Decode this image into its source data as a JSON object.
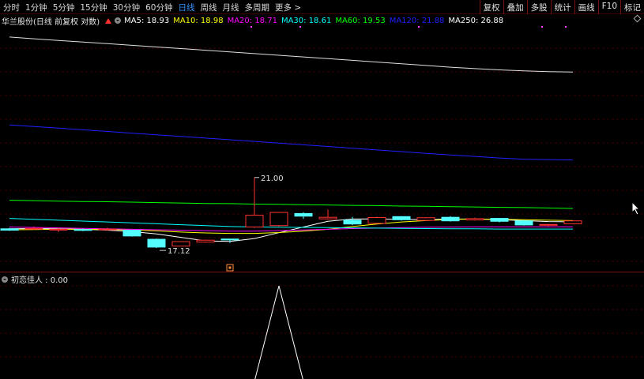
{
  "toolbar": {
    "period_tabs": [
      "分时",
      "1分钟",
      "5分钟",
      "15分钟",
      "30分钟",
      "60分钟",
      "日线",
      "周线",
      "月线",
      "多周期",
      "更多 >"
    ],
    "active_tab_index": 6,
    "right_tools": [
      "复权",
      "叠加",
      "多股",
      "统计",
      "画线",
      "F10",
      "标记"
    ]
  },
  "legend": {
    "stock_name": "华兰股份(日线 前复权 对数)",
    "ma": [
      {
        "label": "MA5: 18.93",
        "color": "#ffffff"
      },
      {
        "label": "MA10: 18.98",
        "color": "#ffff00"
      },
      {
        "label": "MA20: 18.71",
        "color": "#ff00ff"
      },
      {
        "label": "MA30: 18.61",
        "color": "#00ffff"
      },
      {
        "label": "MA60: 19.53",
        "color": "#00ff00"
      },
      {
        "label": "MA120: 21.88",
        "color": "#2020ff"
      },
      {
        "label": "MA250: 26.88",
        "color": "#ffffff"
      }
    ]
  },
  "annotations": {
    "high_label": "21.00",
    "low_label": "17.12"
  },
  "indicator": {
    "label": "初恋佳人 : 0.00"
  },
  "chart_data": {
    "type": "candlestick",
    "candles": [
      {
        "o": 18.62,
        "c": 18.56,
        "h": 18.66,
        "l": 18.53
      },
      {
        "o": 18.62,
        "c": 18.64,
        "h": 18.72,
        "l": 18.58
      },
      {
        "o": 18.6,
        "c": 18.6,
        "h": 18.66,
        "l": 18.48
      },
      {
        "o": 18.59,
        "c": 18.55,
        "h": 18.63,
        "l": 18.52
      },
      {
        "o": 18.61,
        "c": 18.61,
        "h": 18.67,
        "l": 18.55
      },
      {
        "o": 18.56,
        "c": 18.31,
        "h": 18.56,
        "l": 18.28
      },
      {
        "o": 18.17,
        "c": 17.84,
        "h": 18.2,
        "l": 17.8
      },
      {
        "o": 17.88,
        "c": 18.07,
        "h": 18.08,
        "l": 17.88
      },
      {
        "o": 18.05,
        "c": 18.13,
        "h": 18.15,
        "l": 18.02
      },
      {
        "o": 18.18,
        "c": 18.14,
        "h": 18.19,
        "l": 18.01
      },
      {
        "o": 18.7,
        "c": 19.22,
        "h": 21.0,
        "l": 18.66
      },
      {
        "o": 18.76,
        "c": 19.35,
        "h": 19.36,
        "l": 18.72
      },
      {
        "o": 19.3,
        "c": 19.18,
        "h": 19.36,
        "l": 19.06
      },
      {
        "o": 19.06,
        "c": 19.13,
        "h": 19.48,
        "l": 19.04
      },
      {
        "o": 19.0,
        "c": 18.83,
        "h": 19.15,
        "l": 18.78
      },
      {
        "o": 18.86,
        "c": 19.12,
        "h": 19.16,
        "l": 18.84
      },
      {
        "o": 19.16,
        "c": 19.02,
        "h": 19.18,
        "l": 18.98
      },
      {
        "o": 18.99,
        "c": 19.11,
        "h": 19.13,
        "l": 18.96
      },
      {
        "o": 19.13,
        "c": 18.97,
        "h": 19.18,
        "l": 18.94
      },
      {
        "o": 19.01,
        "c": 19.07,
        "h": 19.12,
        "l": 18.98
      },
      {
        "o": 19.08,
        "c": 18.95,
        "h": 19.1,
        "l": 18.9
      },
      {
        "o": 18.97,
        "c": 18.79,
        "h": 19.0,
        "l": 18.76
      },
      {
        "o": 18.79,
        "c": 18.81,
        "h": 18.83,
        "l": 18.74
      },
      {
        "o": 18.84,
        "c": 18.97,
        "h": 18.98,
        "l": 18.82
      }
    ],
    "ma_lines": {
      "MA5": [
        18.62,
        18.63,
        18.62,
        18.6,
        18.56,
        18.5,
        18.4,
        18.25,
        18.1,
        18.08,
        18.2,
        18.45,
        18.7,
        18.95,
        19.05,
        19.06,
        19.04,
        19.02,
        19.05,
        19.05,
        19.02,
        18.98,
        18.94,
        18.93
      ],
      "MA10": [
        18.58,
        18.59,
        18.6,
        18.6,
        18.59,
        18.57,
        18.53,
        18.48,
        18.44,
        18.42,
        18.42,
        18.46,
        18.52,
        18.6,
        18.72,
        18.83,
        18.92,
        18.98,
        19.03,
        19.05,
        19.04,
        19.02,
        19.0,
        18.98
      ],
      "MA20": [
        18.7,
        18.68,
        18.66,
        18.64,
        18.62,
        18.6,
        18.58,
        18.56,
        18.54,
        18.52,
        18.52,
        18.54,
        18.57,
        18.6,
        18.63,
        18.65,
        18.67,
        18.69,
        18.7,
        18.71,
        18.71,
        18.71,
        18.71,
        18.71
      ],
      "MA30": [
        19.08,
        19.04,
        19.0,
        18.96,
        18.92,
        18.88,
        18.84,
        18.8,
        18.76,
        18.72,
        18.7,
        18.69,
        18.68,
        18.67,
        18.66,
        18.65,
        18.64,
        18.63,
        18.62,
        18.62,
        18.61,
        18.61,
        18.61,
        18.61
      ],
      "MA60": [
        19.91,
        19.89,
        19.87,
        19.85,
        19.84,
        19.82,
        19.8,
        19.78,
        19.76,
        19.75,
        19.73,
        19.72,
        19.7,
        19.69,
        19.67,
        19.66,
        19.64,
        19.63,
        19.61,
        19.6,
        19.58,
        19.57,
        19.55,
        19.53
      ],
      "MA120": [
        23.75,
        23.66,
        23.57,
        23.48,
        23.39,
        23.3,
        23.21,
        23.12,
        23.03,
        22.94,
        22.85,
        22.76,
        22.67,
        22.58,
        22.49,
        22.4,
        22.31,
        22.22,
        22.14,
        22.06,
        21.98,
        21.92,
        21.9,
        21.88
      ],
      "MA250": [
        29.18,
        29.06,
        28.95,
        28.84,
        28.73,
        28.62,
        28.51,
        28.4,
        28.29,
        28.18,
        28.07,
        27.96,
        27.85,
        27.74,
        27.63,
        27.52,
        27.41,
        27.3,
        27.19,
        27.1,
        27.02,
        26.96,
        26.91,
        26.88
      ]
    },
    "indicator_values": [
      0,
      0,
      0,
      0,
      0,
      0,
      0,
      0,
      0,
      0,
      0,
      1,
      0,
      0,
      0,
      0,
      0,
      0,
      0,
      0,
      0,
      0,
      0,
      0
    ],
    "ylim": [
      17.0,
      29.5
    ]
  }
}
